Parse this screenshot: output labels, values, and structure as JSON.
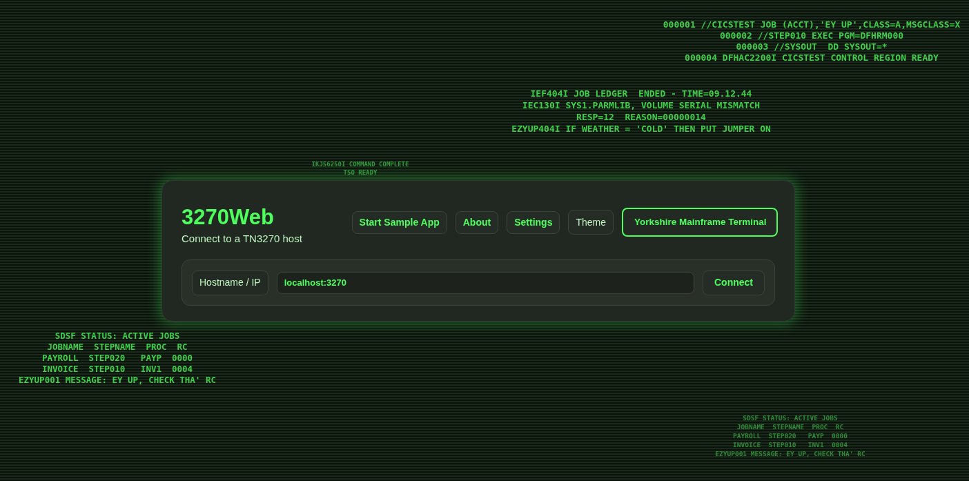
{
  "background_logs": [
    {
      "lines": [
        "000001 //CICSTEST JOB (ACCT),'EY UP',CLASS=A,MSGCLASS=X",
        "000002 //STEP010 EXEC PGM=DFHRM000",
        "000003 //SYSOUT  DD SYSOUT=*",
        "000004 DFHAC2200I CICSTEST CONTROL REGION READY"
      ]
    },
    {
      "lines": [
        "IEF404I JOB LEDGER  ENDED - TIME=09.12.44",
        "IEC130I SYS1.PARMLIB, VOLUME SERIAL MISMATCH",
        "RESP=12  REASON=00000014",
        "EZYUP404I IF WEATHER = 'COLD' THEN PUT JUMPER ON"
      ]
    },
    {
      "lines": [
        "IKJ56250I COMMAND COMPLETE",
        "TSO READY"
      ]
    },
    {
      "lines": [
        "SDSF STATUS: ACTIVE JOBS",
        "JOBNAME  STEPNAME  PROC  RC",
        "PAYROLL  STEP020   PAYP  0000",
        "INVOICE  STEP010   INV1  0004",
        "EZYUP001 MESSAGE: EY UP, CHECK THA' RC"
      ]
    },
    {
      "lines": [
        "SDSF STATUS: ACTIVE JOBS",
        "JOBNAME  STEPNAME  PROC  RC",
        "PAYROLL  STEP020   PAYP  0000",
        "INVOICE  STEP010   INV1  0004",
        "EZYUP001 MESSAGE: EY UP, CHECK THA' RC"
      ]
    }
  ],
  "app": {
    "title": "3270Web",
    "subtitle": "Connect to a TN3270 host",
    "buttons": [
      "Start Sample App",
      "About",
      "Settings"
    ],
    "theme_label": "Theme",
    "theme_select": {
      "value": "Yorkshire Mainframe Terminal"
    },
    "host_label": "Hostname / IP",
    "host_field": {
      "value": "localhost:3270"
    },
    "connect_button": "Connect"
  }
}
